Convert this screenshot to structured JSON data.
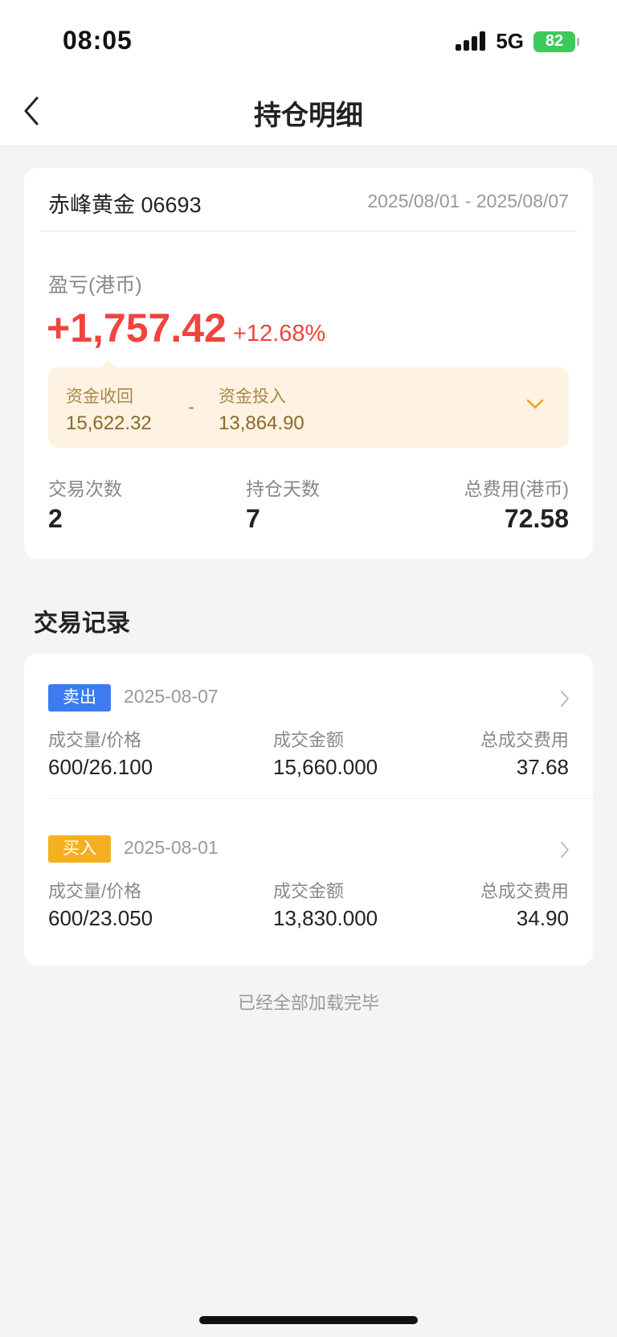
{
  "status_bar": {
    "time": "08:05",
    "network": "5G",
    "battery": "82"
  },
  "nav": {
    "title": "持仓明细"
  },
  "summary": {
    "stock_name": "赤峰黄金 06693",
    "date_range": "2025/08/01 - 2025/08/07",
    "pl_label": "盈亏(港币)",
    "pl_value": "+1,757.42",
    "pl_percent": "+12.68%",
    "fund_return_label": "资金收回",
    "fund_return_value": "15,622.32",
    "fund_minus": "-",
    "fund_invest_label": "资金投入",
    "fund_invest_value": "13,864.90",
    "stats": [
      {
        "label": "交易次数",
        "value": "2"
      },
      {
        "label": "持仓天数",
        "value": "7"
      },
      {
        "label": "总费用(港币)",
        "value": "72.58"
      }
    ]
  },
  "records_section": {
    "title": "交易记录"
  },
  "records": [
    {
      "tag": "卖出",
      "date": "2025-08-07",
      "qty_label": "成交量/价格",
      "qty_value": "600/26.100",
      "amount_label": "成交金额",
      "amount_value": "15,660.000",
      "fee_label": "总成交费用",
      "fee_value": "37.68"
    },
    {
      "tag": "买入",
      "date": "2025-08-01",
      "qty_label": "成交量/价格",
      "qty_value": "600/23.050",
      "amount_label": "成交金额",
      "amount_value": "13,830.000",
      "fee_label": "总成交费用",
      "fee_value": "34.90"
    }
  ],
  "footer": {
    "text": "已经全部加载完毕"
  },
  "colors": {
    "profit": "#f0443d",
    "sell_tag": "#3d7cf0",
    "buy_tag": "#f5b021",
    "fund_box": "#fef2e2"
  }
}
